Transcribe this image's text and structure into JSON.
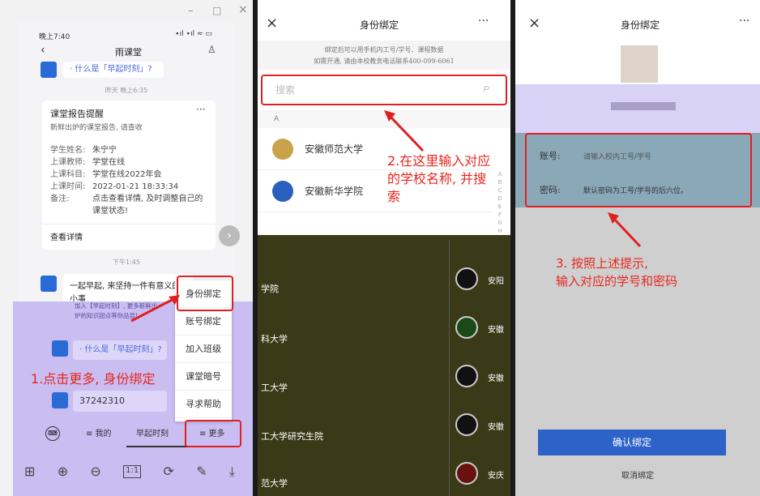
{
  "panel1": {
    "window_controls": {
      "minimize": "–",
      "maximize": "□",
      "close": "×"
    },
    "status_time": "晚上7:40",
    "status_icons": "∙ıl ∙ıl ≈ ▭",
    "app_title": "雨课堂",
    "msg_top": "· 什么是「早起时刻」?",
    "ts1": "昨天 晚上6:35",
    "card": {
      "title": "课堂报告提醒",
      "subtitle": "新鲜出炉的课堂报告, 请查收",
      "rows": [
        {
          "k": "学生姓名:",
          "v": "朱宁宁"
        },
        {
          "k": "上课教师:",
          "v": "学堂在线"
        },
        {
          "k": "上课科目:",
          "v": "学堂在线2022年会"
        },
        {
          "k": "上课时间:",
          "v": "2022-01-21 18:33:34"
        },
        {
          "k": "备注:",
          "v": "点击查看详情, 及时调整自己的课堂状态!"
        }
      ],
      "link": "查看详情"
    },
    "ts2": "下午1:45",
    "msg2": "一起早起, 来坚持一件有意义的",
    "msg2b": "小事",
    "msg2c": "加入【早起时刻】, 更多新鲜出炉的知识甜点等你品尝!",
    "msg3": "· 什么是「早起时刻」?",
    "msg4": "37242310",
    "menu": [
      "身份绑定",
      "账号绑定",
      "加入班级",
      "课堂暗号",
      "寻求帮助"
    ],
    "tabs": [
      "≡ 我的",
      "早起时刻",
      "≡ 更多"
    ],
    "annotation": "1.点击更多, 身份绑定"
  },
  "panel2": {
    "title": "身份绑定",
    "more": "···",
    "close": "×",
    "info_line1": "绑定后可以用手机内工号/学号、课程数据",
    "info_line2": "如需开通, 请由本校教务电话联系400-099-6061",
    "search_placeholder": "搜索",
    "section": "A",
    "schools": [
      "安徽师范大学",
      "安徽新华学院"
    ],
    "dark_items": [
      "学院",
      "科大学",
      "工大学",
      "工大学研究生院",
      "范大学"
    ],
    "dark_right": [
      "安阳",
      "安徽",
      "安徽",
      "安徽",
      "安庆"
    ],
    "index_letters": "ABCDEFGHIJKLMNOPQRSTUVWXYZ#",
    "annotation": "2.在这里输入对应的学校名称, 并搜索"
  },
  "panel3": {
    "title": "身份绑定",
    "more": "···",
    "close": "×",
    "account_label": "账号:",
    "account_placeholder": "请输入校内工号/学号",
    "password_label": "密码:",
    "password_placeholder": "默认密码为工号/学号的后六位。",
    "confirm": "确认绑定",
    "cancel": "取消绑定",
    "annotation_line1": "3. 按照上述提示,",
    "annotation_line2": "输入对应的学号和密码"
  },
  "colors": {
    "red": "#e8271d",
    "blue_button": "#2d63c8",
    "purple_overlay": "#c9bdf2",
    "dark_overlay": "#3a3a18"
  }
}
